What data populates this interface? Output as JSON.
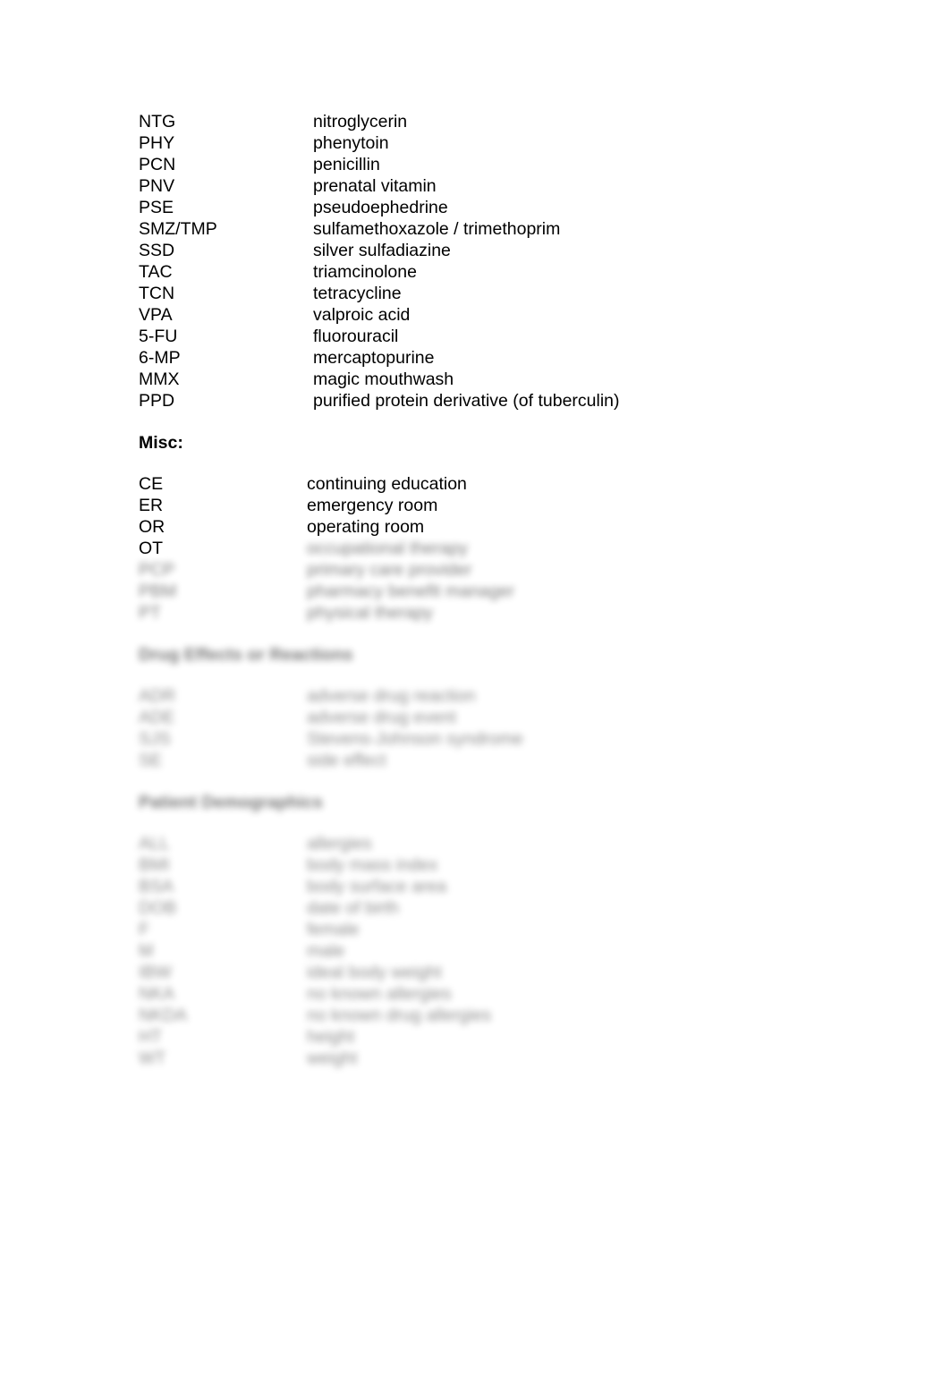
{
  "document": {
    "type": "medical abbreviations reference list",
    "background_color": "#ffffff",
    "text_color": "#000000"
  },
  "drug_list": {
    "legible": true,
    "rows": [
      {
        "abbr": "NTG",
        "definition": "nitroglycerin"
      },
      {
        "abbr": "PHY",
        "definition": "phenytoin"
      },
      {
        "abbr": "PCN",
        "definition": "penicillin"
      },
      {
        "abbr": "PNV",
        "definition": "prenatal vitamin"
      },
      {
        "abbr": "PSE",
        "definition": "pseudoephedrine"
      },
      {
        "abbr": "SMZ/TMP",
        "definition": "sulfamethoxazole / trimethoprim"
      },
      {
        "abbr": "SSD",
        "definition": "silver sulfadiazine"
      },
      {
        "abbr": "TAC",
        "definition": "triamcinolone"
      },
      {
        "abbr": "TCN",
        "definition": "tetracycline"
      },
      {
        "abbr": "VPA",
        "definition": "valproic acid"
      },
      {
        "abbr": "5-FU",
        "definition": "fluorouracil"
      },
      {
        "abbr": "6-MP",
        "definition": "mercaptopurine"
      },
      {
        "abbr": "MMX",
        "definition": "magic mouthwash"
      },
      {
        "abbr": "PPD",
        "definition": "purified protein derivative (of tuberculin)"
      }
    ]
  },
  "misc_section": {
    "heading": "Misc:",
    "legible_rows": [
      {
        "abbr": "CE",
        "definition": "continuing education"
      },
      {
        "abbr": "ER",
        "definition": "emergency room"
      },
      {
        "abbr": "OR",
        "definition": "operating room"
      },
      {
        "abbr": "OT",
        "definition": ""
      }
    ],
    "blurred_rows": [
      {
        "abbr": "OT",
        "definition": "occupational therapy"
      },
      {
        "abbr": "PCP",
        "definition": "primary care provider"
      },
      {
        "abbr": "PBM",
        "definition": "pharmacy benefit manager"
      },
      {
        "abbr": "PT",
        "definition": "physical therapy"
      }
    ]
  },
  "blurred_section_two": {
    "heading": "Drug Effects or Reactions",
    "rows": [
      {
        "abbr": "ADR",
        "definition": "adverse drug reaction"
      },
      {
        "abbr": "ADE",
        "definition": "adverse drug event"
      },
      {
        "abbr": "SJS",
        "definition": "Stevens-Johnson syndrome"
      },
      {
        "abbr": "SE",
        "definition": "side effect"
      }
    ]
  },
  "blurred_section_three": {
    "heading": "Patient Demographics",
    "rows": [
      {
        "abbr": "ALL",
        "definition": "allergies"
      },
      {
        "abbr": "BMI",
        "definition": "body mass index"
      },
      {
        "abbr": "BSA",
        "definition": "body surface area"
      },
      {
        "abbr": "DOB",
        "definition": "date of birth"
      },
      {
        "abbr": "F",
        "definition": "female"
      },
      {
        "abbr": "M",
        "definition": "male"
      },
      {
        "abbr": "IBW",
        "definition": "ideal body weight"
      },
      {
        "abbr": "NKA",
        "definition": "no known allergies"
      },
      {
        "abbr": "NKDA",
        "definition": "no known drug allergies"
      },
      {
        "abbr": "HT",
        "definition": "height"
      },
      {
        "abbr": "WT",
        "definition": "weight"
      }
    ]
  }
}
